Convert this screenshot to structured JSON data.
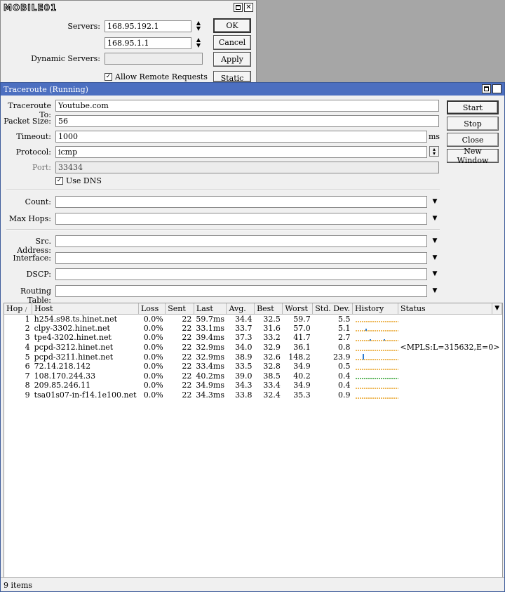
{
  "dns_window": {
    "logo": "MOBILE01",
    "servers_label": "Servers:",
    "server1": "168.95.192.1",
    "server2": "168.95.1.1",
    "dynamic_label": "Dynamic Servers:",
    "dynamic_value": "",
    "allow_remote_label": "Allow Remote Requests",
    "allow_remote_checked": true,
    "buttons": {
      "ok": "OK",
      "cancel": "Cancel",
      "apply": "Apply",
      "static": "Static"
    }
  },
  "traceroute": {
    "title": "Traceroute (Running)",
    "labels": {
      "to": "Traceroute To:",
      "packet_size": "Packet Size:",
      "timeout": "Timeout:",
      "protocol": "Protocol:",
      "port": "Port:",
      "use_dns": "Use DNS",
      "count": "Count:",
      "max_hops": "Max Hops:",
      "src_address": "Src. Address:",
      "interface": "Interface:",
      "dscp": "DSCP:",
      "routing_table": "Routing Table:",
      "ms_unit": "ms"
    },
    "values": {
      "to": "Youtube.com",
      "packet_size": "56",
      "timeout": "1000",
      "protocol": "icmp",
      "port": "33434",
      "use_dns": true
    },
    "buttons": {
      "start": "Start",
      "stop": "Stop",
      "close": "Close",
      "new_window": "New Window"
    },
    "columns": [
      "Hop",
      "Host",
      "Loss",
      "Sent",
      "Last",
      "Avg.",
      "Best",
      "Worst",
      "Std. Dev.",
      "History",
      "Status"
    ],
    "rows": [
      {
        "hop": "1",
        "host": "h254.s98.ts.hinet.net",
        "loss": "0.0%",
        "sent": "22",
        "last": "59.7ms",
        "avg": "34.4",
        "best": "32.5",
        "worst": "59.7",
        "std": "5.5",
        "status": ""
      },
      {
        "hop": "2",
        "host": "clpy-3302.hinet.net",
        "loss": "0.0%",
        "sent": "22",
        "last": "33.1ms",
        "avg": "33.7",
        "best": "31.6",
        "worst": "57.0",
        "std": "5.1",
        "status": ""
      },
      {
        "hop": "3",
        "host": "tpe4-3202.hinet.net",
        "loss": "0.0%",
        "sent": "22",
        "last": "39.4ms",
        "avg": "37.3",
        "best": "33.2",
        "worst": "41.7",
        "std": "2.7",
        "status": ""
      },
      {
        "hop": "4",
        "host": "pcpd-3212.hinet.net",
        "loss": "0.0%",
        "sent": "22",
        "last": "32.9ms",
        "avg": "34.0",
        "best": "32.9",
        "worst": "36.1",
        "std": "0.8",
        "status": "<MPLS:L=315632,E=0>"
      },
      {
        "hop": "5",
        "host": "pcpd-3211.hinet.net",
        "loss": "0.0%",
        "sent": "22",
        "last": "32.9ms",
        "avg": "38.9",
        "best": "32.6",
        "worst": "148.2",
        "std": "23.9",
        "status": ""
      },
      {
        "hop": "6",
        "host": "72.14.218.142",
        "loss": "0.0%",
        "sent": "22",
        "last": "33.4ms",
        "avg": "33.5",
        "best": "32.8",
        "worst": "34.9",
        "std": "0.5",
        "status": ""
      },
      {
        "hop": "7",
        "host": "108.170.244.33",
        "loss": "0.0%",
        "sent": "22",
        "last": "40.2ms",
        "avg": "39.0",
        "best": "38.5",
        "worst": "40.2",
        "std": "0.4",
        "status": ""
      },
      {
        "hop": "8",
        "host": "209.85.246.11",
        "loss": "0.0%",
        "sent": "22",
        "last": "34.9ms",
        "avg": "34.3",
        "best": "33.4",
        "worst": "34.9",
        "std": "0.4",
        "status": ""
      },
      {
        "hop": "9",
        "host": "tsa01s07-in-f14.1e100.net",
        "loss": "0.0%",
        "sent": "22",
        "last": "34.3ms",
        "avg": "33.8",
        "best": "32.4",
        "worst": "35.3",
        "std": "0.9",
        "status": ""
      }
    ],
    "history_colors": {
      "orange": "#e8a020",
      "blue": "#2c7bd0",
      "green": "#30a030"
    },
    "status_bar": "9 items"
  }
}
